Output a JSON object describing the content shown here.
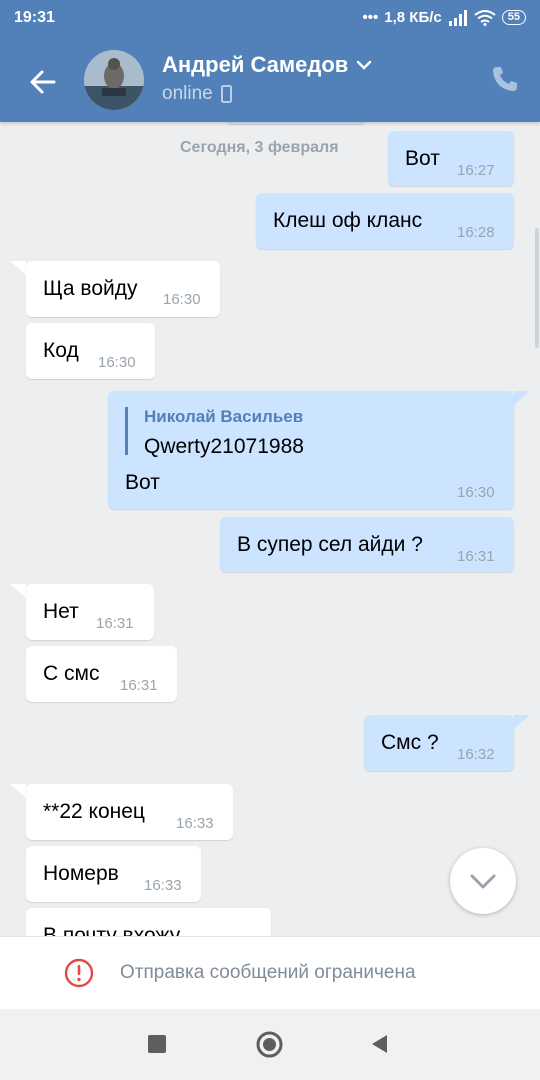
{
  "status_bar": {
    "time": "19:31",
    "net_speed": "1,8 КБ/с",
    "battery": "55"
  },
  "header": {
    "contact_name": "Андрей Самедов",
    "presence": "online"
  },
  "date_separator": "Сегодня, 3 февраля",
  "messages": [
    {
      "text": "Вот",
      "time": "16:27"
    },
    {
      "text": "Клеш оф кланс",
      "time": "16:28"
    },
    {
      "text": "Ща войду",
      "time": "16:30"
    },
    {
      "text": "Код",
      "time": "16:30"
    },
    {
      "text": "Вот",
      "time": "16:30",
      "quote_author": "Николай Васильев",
      "quote_text": "Qwerty21071988"
    },
    {
      "text": "В супер сел айди ?",
      "time": "16:31"
    },
    {
      "text": "Нет",
      "time": "16:31"
    },
    {
      "text": "С смс",
      "time": "16:31"
    },
    {
      "text": "Смс ?",
      "time": "16:32"
    },
    {
      "text": "**22 конец",
      "time": "16:33"
    },
    {
      "text": "Номерв",
      "time": "16:33"
    },
    {
      "text": "В почту вхожу",
      "time": ""
    }
  ],
  "bottom": {
    "restricted_notice": "Отправка сообщений ограничена"
  },
  "colors": {
    "header": "#5181b8",
    "incoming": "#ffffff",
    "outgoing": "#cce4ff",
    "background": "#edeef0"
  }
}
